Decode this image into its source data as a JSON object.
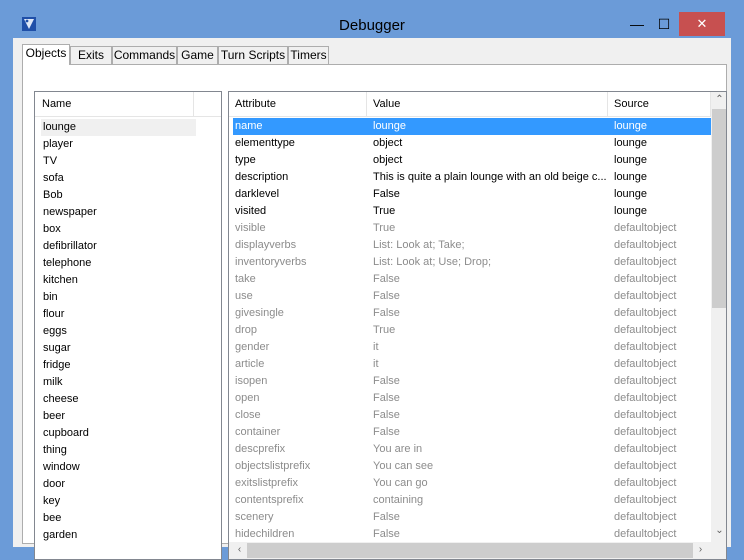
{
  "window": {
    "title": "Debugger",
    "minimize_glyph": "—",
    "maximize_glyph": "☐",
    "close_glyph": "✕"
  },
  "tabs": [
    {
      "label": "Objects",
      "active": true
    },
    {
      "label": "Exits",
      "active": false
    },
    {
      "label": "Commands",
      "active": false
    },
    {
      "label": "Game",
      "active": false
    },
    {
      "label": "Turn Scripts",
      "active": false
    },
    {
      "label": "Timers",
      "active": false
    }
  ],
  "objects_list": {
    "header": "Name",
    "selected": "lounge",
    "items": [
      "lounge",
      "player",
      "TV",
      "sofa",
      "Bob",
      "newspaper",
      "box",
      "defibrillator",
      "telephone",
      "kitchen",
      "bin",
      "flour",
      "eggs",
      "sugar",
      "fridge",
      "milk",
      "cheese",
      "beer",
      "cupboard",
      "thing",
      "window",
      "door",
      "key",
      "bee",
      "garden"
    ]
  },
  "attributes_table": {
    "headers": {
      "attribute": "Attribute",
      "value": "Value",
      "source": "Source"
    },
    "rows": [
      {
        "attribute": "name",
        "value": "lounge",
        "source": "lounge",
        "state": "selected"
      },
      {
        "attribute": "elementtype",
        "value": "object",
        "source": "lounge",
        "state": "own"
      },
      {
        "attribute": "type",
        "value": "object",
        "source": "lounge",
        "state": "own"
      },
      {
        "attribute": "description",
        "value": "This is quite a plain lounge with an old beige c...",
        "source": "lounge",
        "state": "own"
      },
      {
        "attribute": "darklevel",
        "value": "False",
        "source": "lounge",
        "state": "own"
      },
      {
        "attribute": "visited",
        "value": "True",
        "source": "lounge",
        "state": "own"
      },
      {
        "attribute": "visible",
        "value": "True",
        "source": "defaultobject",
        "state": "inherited"
      },
      {
        "attribute": "displayverbs",
        "value": "List: Look at; Take;",
        "source": "defaultobject",
        "state": "inherited"
      },
      {
        "attribute": "inventoryverbs",
        "value": "List: Look at; Use; Drop;",
        "source": "defaultobject",
        "state": "inherited"
      },
      {
        "attribute": "take",
        "value": "False",
        "source": "defaultobject",
        "state": "inherited"
      },
      {
        "attribute": "use",
        "value": "False",
        "source": "defaultobject",
        "state": "inherited"
      },
      {
        "attribute": "givesingle",
        "value": "False",
        "source": "defaultobject",
        "state": "inherited"
      },
      {
        "attribute": "drop",
        "value": "True",
        "source": "defaultobject",
        "state": "inherited"
      },
      {
        "attribute": "gender",
        "value": "it",
        "source": "defaultobject",
        "state": "inherited"
      },
      {
        "attribute": "article",
        "value": "it",
        "source": "defaultobject",
        "state": "inherited"
      },
      {
        "attribute": "isopen",
        "value": "False",
        "source": "defaultobject",
        "state": "inherited"
      },
      {
        "attribute": "open",
        "value": "False",
        "source": "defaultobject",
        "state": "inherited"
      },
      {
        "attribute": "close",
        "value": "False",
        "source": "defaultobject",
        "state": "inherited"
      },
      {
        "attribute": "container",
        "value": "False",
        "source": "defaultobject",
        "state": "inherited"
      },
      {
        "attribute": "descprefix",
        "value": "You are in",
        "source": "defaultobject",
        "state": "inherited"
      },
      {
        "attribute": "objectslistprefix",
        "value": "You can see",
        "source": "defaultobject",
        "state": "inherited"
      },
      {
        "attribute": "exitslistprefix",
        "value": "You can go",
        "source": "defaultobject",
        "state": "inherited"
      },
      {
        "attribute": "contentsprefix",
        "value": "containing",
        "source": "defaultobject",
        "state": "inherited"
      },
      {
        "attribute": "scenery",
        "value": "False",
        "source": "defaultobject",
        "state": "inherited"
      },
      {
        "attribute": "hidechildren",
        "value": "False",
        "source": "defaultobject",
        "state": "inherited"
      }
    ]
  },
  "scrollbars": {
    "up": "⌃",
    "down": "⌄",
    "left": "‹",
    "right": "›"
  },
  "colors": {
    "title_bar": "#6b9bd8",
    "close_button": "#c75050",
    "selection": "#3399ff",
    "inherited_text": "#8c8c8c"
  }
}
